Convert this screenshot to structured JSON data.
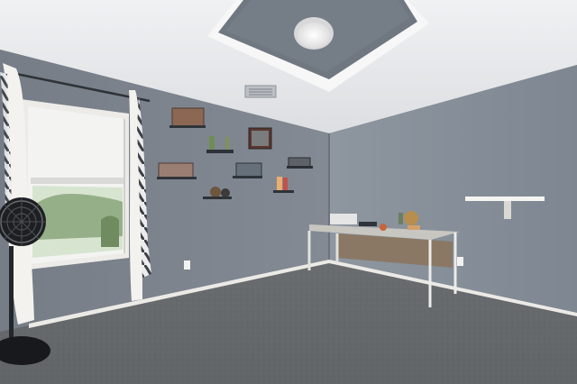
{
  "scene": {
    "palette": {
      "wall_left": "#7b828c",
      "wall_right": "#87909a",
      "ceiling": "#e6e7e9",
      "ceiling_recess": "#6d747d",
      "carpet": "#676b6d",
      "trim": "#f3f3f1",
      "window_light": "#f5f6f4",
      "table_wood": "#8a7a68"
    },
    "objects": [
      "ceiling-light",
      "tray-ceiling",
      "window",
      "curtains",
      "wall-shelves",
      "desk",
      "standing-fan",
      "air-vent",
      "wall-shelf-right",
      "carpet-floor"
    ]
  }
}
